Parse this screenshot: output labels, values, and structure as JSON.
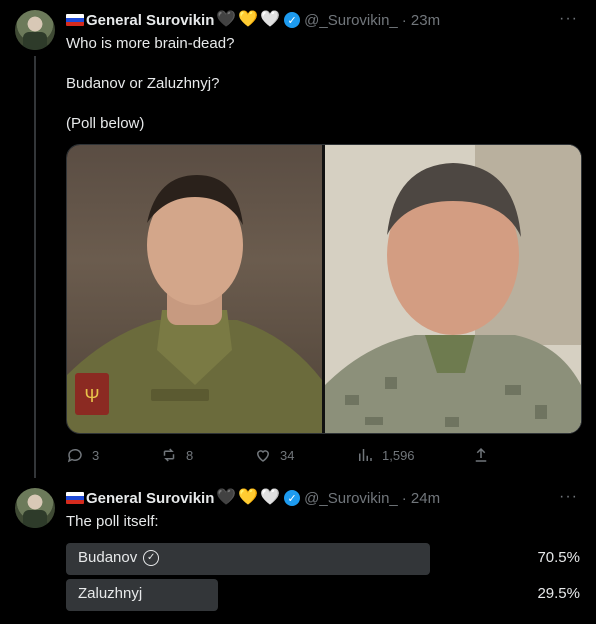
{
  "tweets": [
    {
      "name": "General Surovikin",
      "hearts": [
        "🖤",
        "💛",
        "🤍"
      ],
      "handle": "@_Surovikin_",
      "time": "· 23m",
      "lines": [
        "Who is more brain-dead?",
        "Budanov or Zaluzhnyj?",
        "(Poll below)"
      ],
      "stats": {
        "replies": "3",
        "reposts": "8",
        "likes": "34",
        "views": "1,596"
      }
    },
    {
      "name": "General Surovikin",
      "hearts": [
        "🖤",
        "💛",
        "🤍"
      ],
      "handle": "@_Surovikin_",
      "time": "· 24m",
      "lines": [
        "The poll itself:"
      ]
    }
  ],
  "poll": {
    "options": [
      {
        "label": "Budanov",
        "percent_text": "70.5%",
        "percent": 70.5,
        "winner": true
      },
      {
        "label": "Zaluzhnyj",
        "percent_text": "29.5%",
        "percent": 29.5,
        "winner": false
      }
    ]
  },
  "colors": {
    "bg": "#000000",
    "text": "#e7e9ea",
    "muted": "#71767b",
    "accent": "#1d9bf0",
    "poll_winner": "#333639",
    "poll_other": "#333639"
  }
}
